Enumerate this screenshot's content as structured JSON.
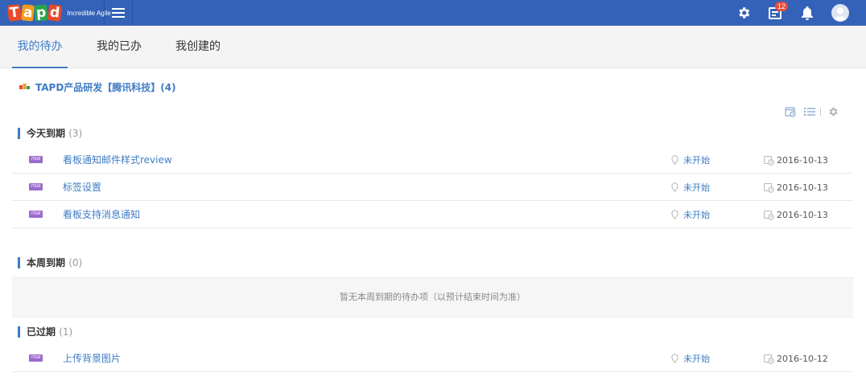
{
  "header": {
    "logo_text": "TAPD",
    "logo_letters": [
      "T",
      "a",
      "p",
      "d"
    ],
    "logo_subtitle": "Incredible Agile",
    "menu_icon": "hamburger-icon",
    "settings_icon": "gear-icon",
    "messages_icon": "message-box-icon",
    "messages_count": "12",
    "notifications_icon": "bell-icon",
    "avatar_icon": "user-avatar-icon",
    "bar_color": "#3462b8",
    "badge_color": "#e84c3d"
  },
  "tabs": [
    {
      "label": "我的待办",
      "active": true
    },
    {
      "label": "我的已办",
      "active": false
    },
    {
      "label": "我创建的",
      "active": false
    }
  ],
  "accent_color": "#3f7cc5",
  "project": {
    "title": "TAPD产品研发【腾讯科技】(4)"
  },
  "toolbar": {
    "calendar_icon": "calendar-icon",
    "list_icon": "list-icon",
    "settings_icon": "gear-icon"
  },
  "sections": [
    {
      "title": "今天到期",
      "count": "(3)",
      "items": [
        {
          "tag": "ITEM",
          "title": "看板通知邮件样式review",
          "status": "未开始",
          "due": "2016-10-13"
        },
        {
          "tag": "ITEM",
          "title": "标签设置",
          "status": "未开始",
          "due": "2016-10-13"
        },
        {
          "tag": "ITEM",
          "title": "看板支持消息通知",
          "status": "未开始",
          "due": "2016-10-13"
        }
      ]
    },
    {
      "title": "本周到期",
      "count": "(0)",
      "empty_text": "暂无本周到期的待办项（以预计结束时间为准）",
      "items": []
    },
    {
      "title": "已过期",
      "count": "(1)",
      "items": [
        {
          "tag": "ITEM",
          "title": "上传背景图片",
          "status": "未开始",
          "due": "2016-10-12"
        }
      ]
    }
  ]
}
